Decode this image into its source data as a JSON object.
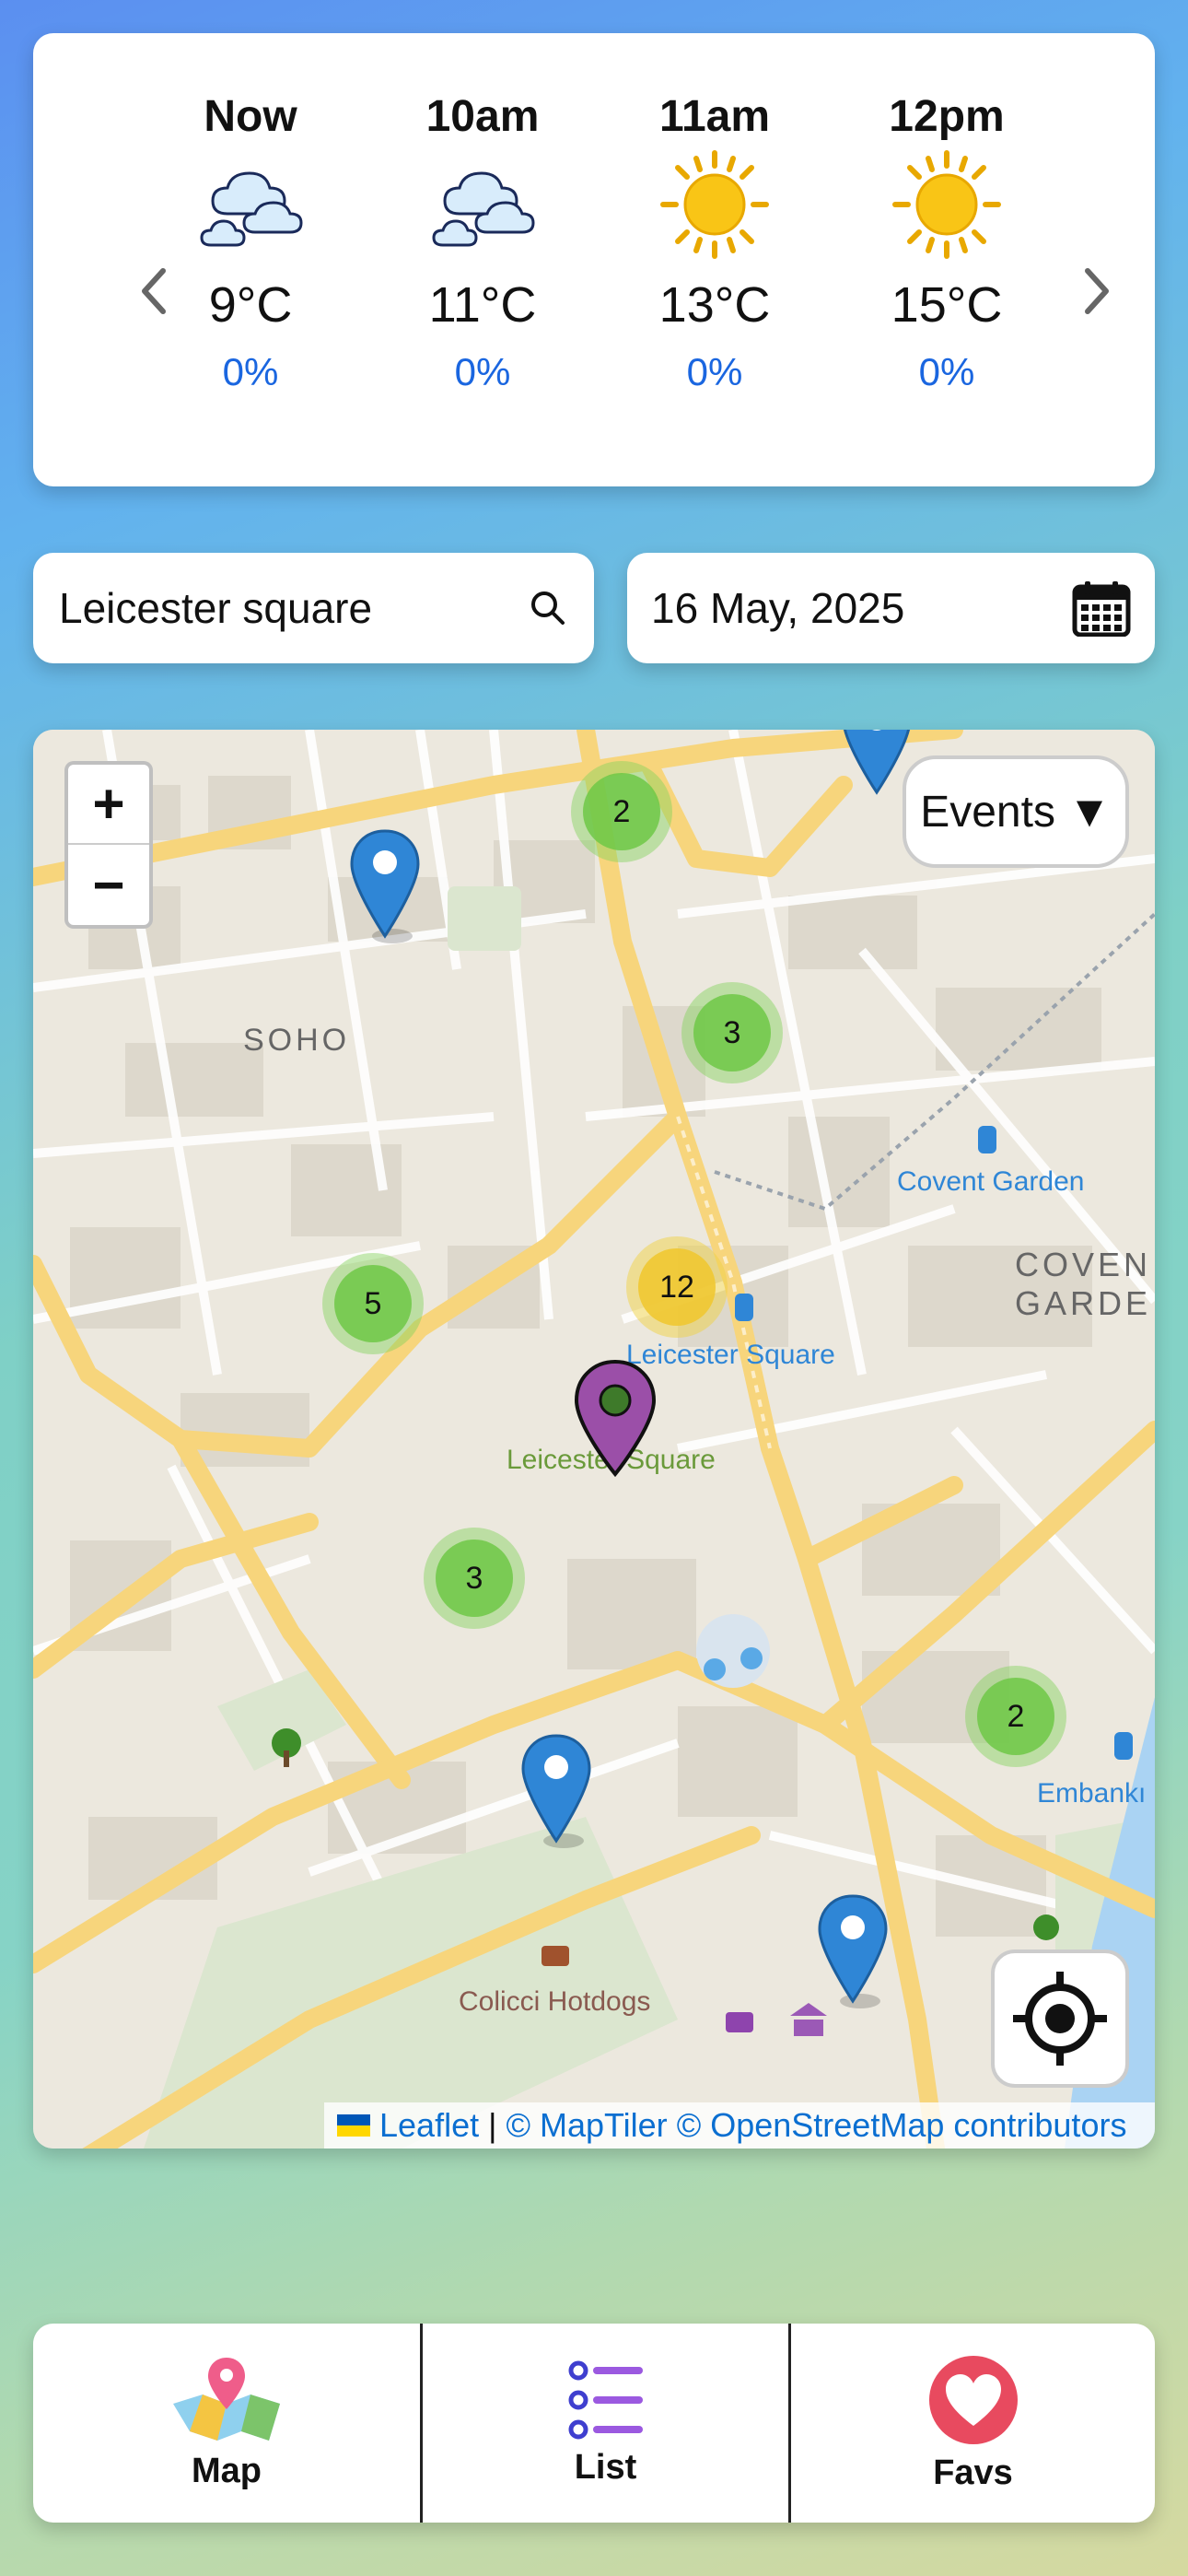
{
  "weather": {
    "prev_icon": "chevron-left-icon",
    "next_icon": "chevron-right-icon",
    "hours": [
      {
        "time": "Now",
        "icon": "cloudy-icon",
        "temp": "9°C",
        "rain": "0%"
      },
      {
        "time": "10am",
        "icon": "cloudy-icon",
        "temp": "11°C",
        "rain": "0%"
      },
      {
        "time": "11am",
        "icon": "sunny-icon",
        "temp": "13°C",
        "rain": "0%"
      },
      {
        "time": "12pm",
        "icon": "sunny-icon",
        "temp": "15°C",
        "rain": "0%"
      }
    ]
  },
  "search": {
    "value": "Leicester square",
    "icon": "search-icon"
  },
  "date": {
    "value": "16 May, 2025",
    "icon": "calendar-icon"
  },
  "map": {
    "zoom_in": "+",
    "zoom_out": "−",
    "filter_label": "Events ▼",
    "clusters": [
      {
        "count": "2",
        "level": "green"
      },
      {
        "count": "3",
        "level": "green"
      },
      {
        "count": "5",
        "level": "green"
      },
      {
        "count": "12",
        "level": "yellow"
      },
      {
        "count": "3",
        "level": "green"
      },
      {
        "count": "2",
        "level": "green"
      }
    ],
    "labels": {
      "soho": "SOHO",
      "covent_garden_station": "Covent Garden",
      "covent_garden_area_1": "COVEN",
      "covent_garden_area_2": "GARDE",
      "leicester_square_station": "Leicester Square",
      "leicester_square_park": "Leicester Square",
      "embankment": "Embankı",
      "colicci": "Colicci Hotdogs"
    },
    "attribution": {
      "leaflet": "Leaflet",
      "sep": " | ",
      "maptiler": "© MapTiler",
      "osm": "© OpenStreetMap contributors"
    },
    "colors": {
      "pin_blue": "#2f86d6",
      "pin_purple": "#9b4fa8",
      "station_blue": "#2f86d6"
    }
  },
  "nav": {
    "items": [
      {
        "label": "Map",
        "icon": "map-icon"
      },
      {
        "label": "List",
        "icon": "list-icon"
      },
      {
        "label": "Favs",
        "icon": "heart-icon"
      }
    ]
  }
}
